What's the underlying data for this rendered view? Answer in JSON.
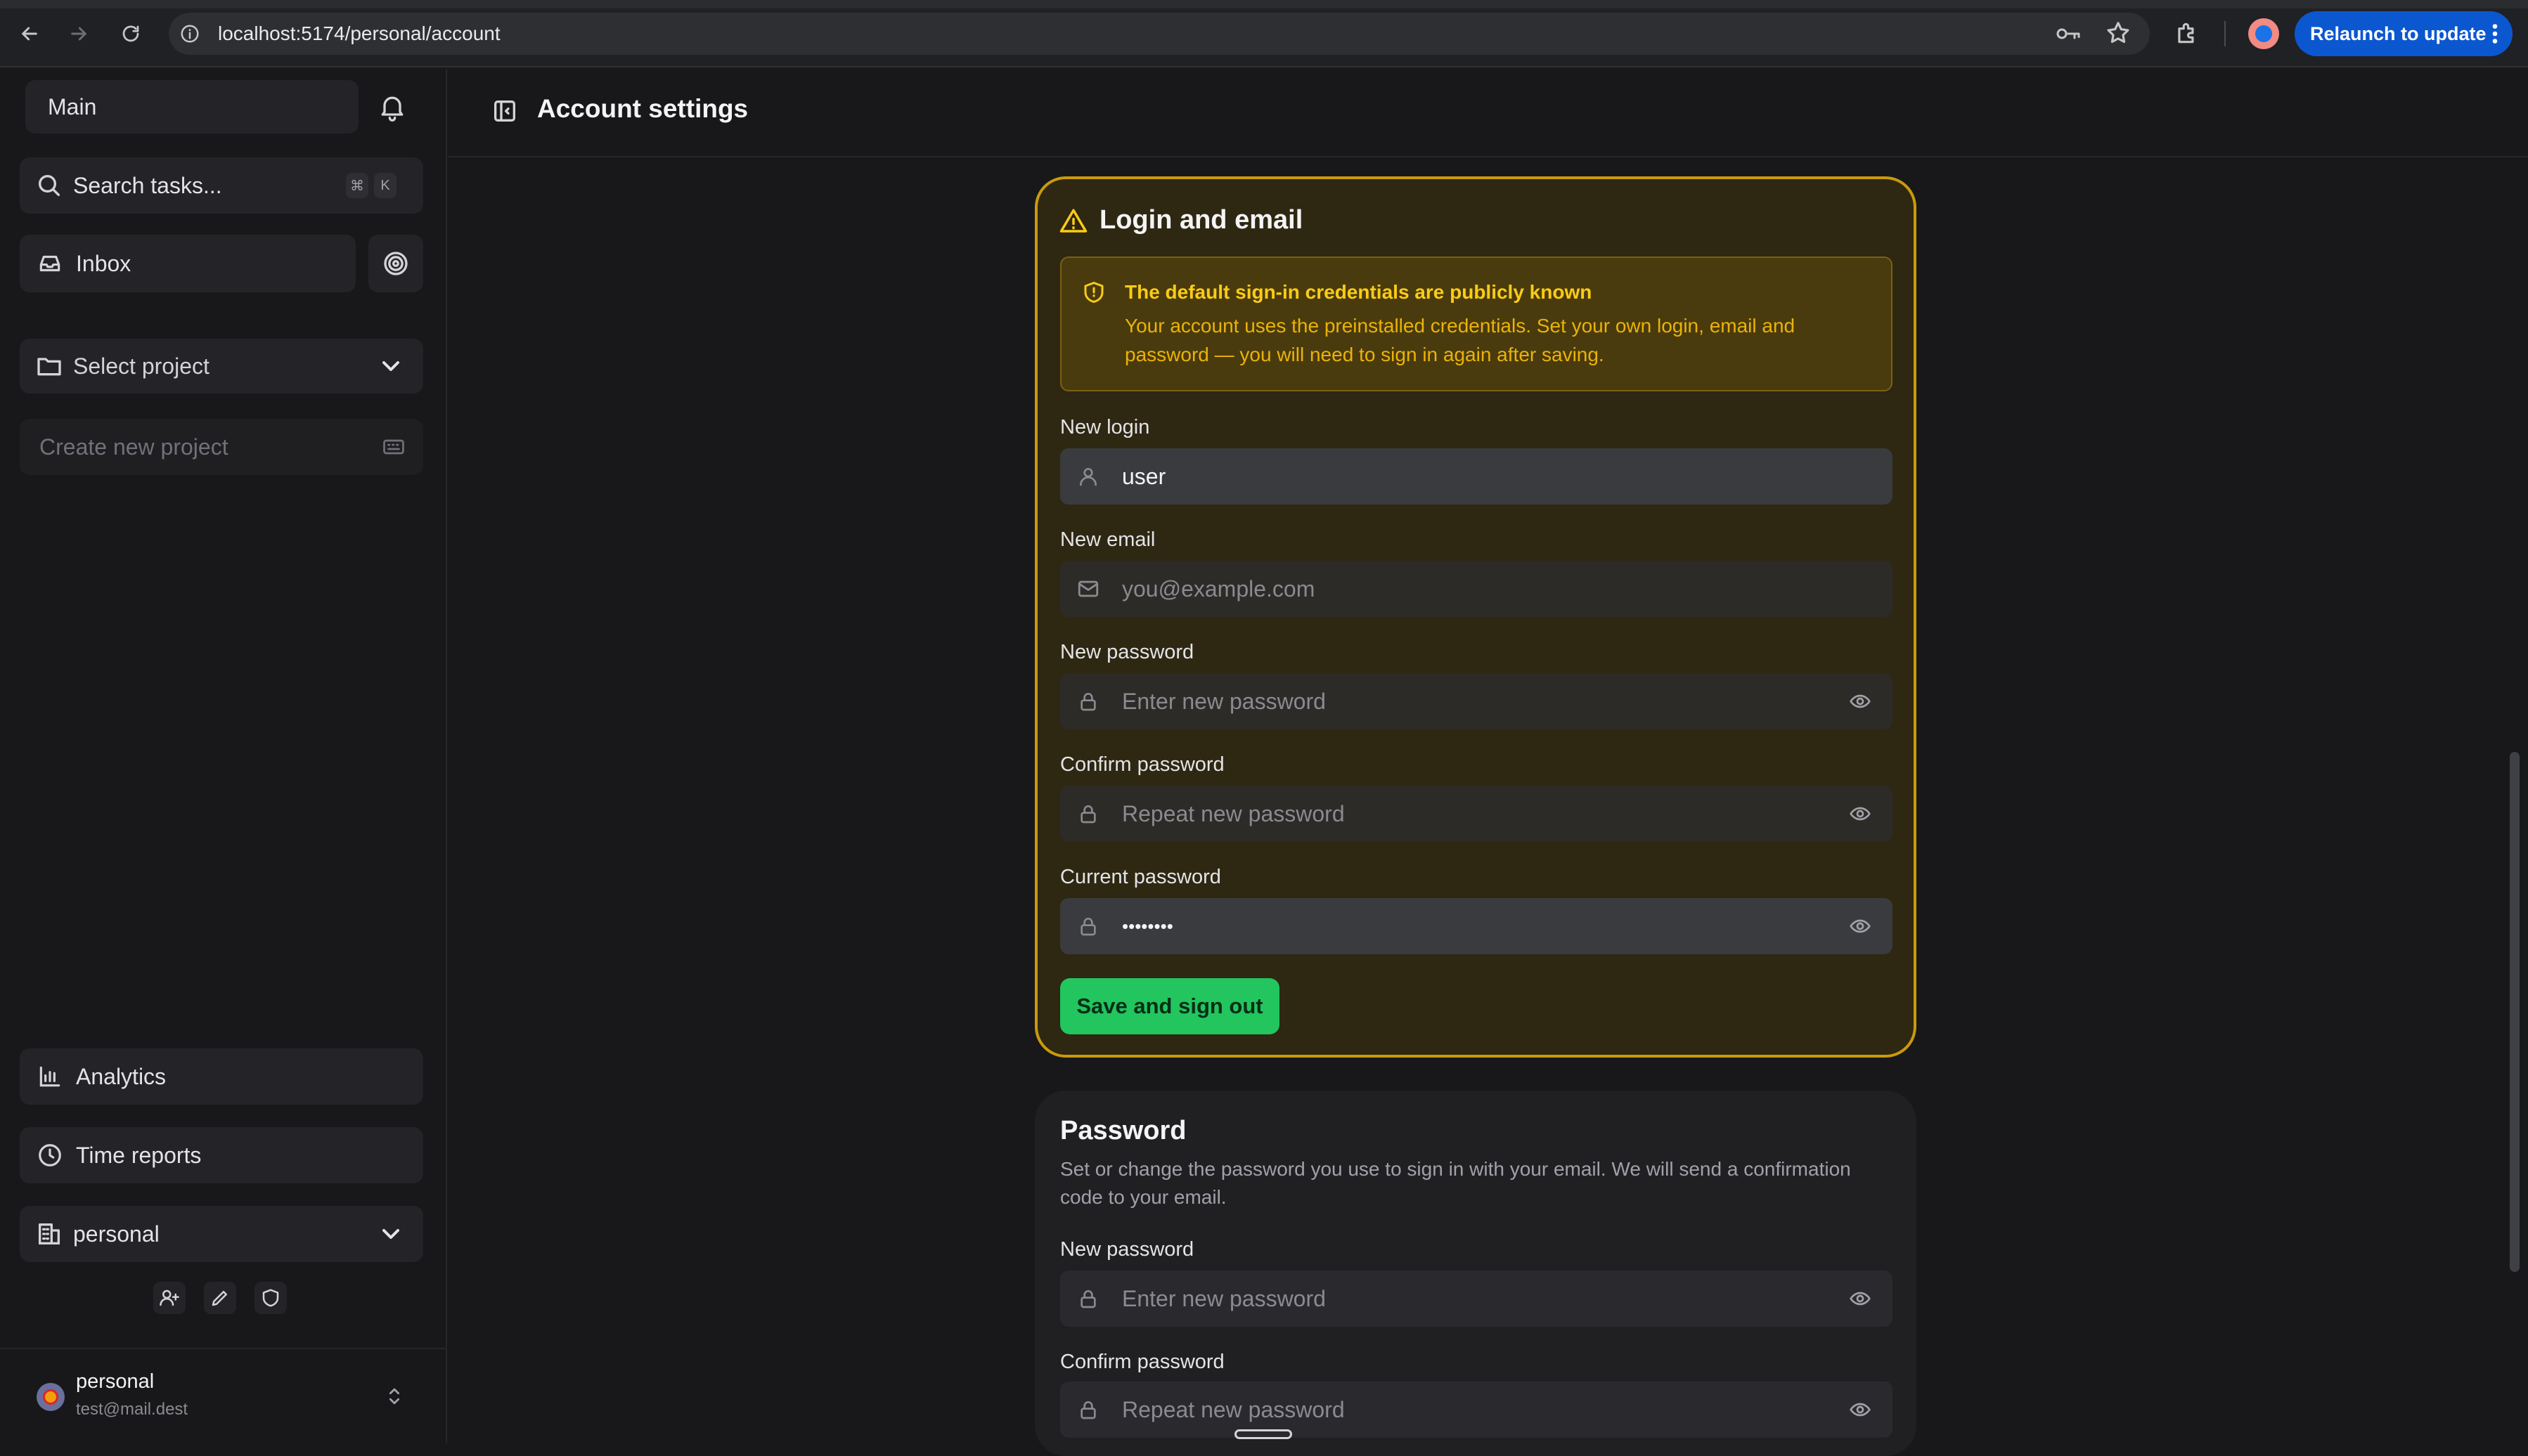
{
  "browser": {
    "url": "localhost:5174/personal/account",
    "relaunch_label": "Relaunch to update"
  },
  "sidebar": {
    "workspace_label": "Main",
    "search_label": "Search tasks...",
    "search_kbd_mod": "⌘",
    "search_kbd_key": "K",
    "inbox_label": "Inbox",
    "project_select_label": "Select project",
    "create_project_placeholder": "Create new project",
    "analytics_label": "Analytics",
    "time_reports_label": "Time reports",
    "organization_label": "personal",
    "user": {
      "name": "personal",
      "email": "test@mail.dest"
    }
  },
  "header": {
    "title": "Account settings"
  },
  "login_card": {
    "title": "Login and email",
    "alert_title": "The default sign-in credentials are publicly known",
    "alert_body": "Your account uses the preinstalled credentials. Set your own login, email and password — you will need to sign in again after saving.",
    "fields": {
      "login": {
        "label": "New login",
        "value": "user"
      },
      "email": {
        "label": "New email",
        "placeholder": "you@example.com"
      },
      "new_password": {
        "label": "New password",
        "placeholder": "Enter new password"
      },
      "confirm_password": {
        "label": "Confirm password",
        "placeholder": "Repeat new password"
      },
      "current_password": {
        "label": "Current password",
        "value": "••••••••"
      }
    },
    "submit_label": "Save and sign out"
  },
  "password_card": {
    "title": "Password",
    "description": "Set or change the password you use to sign in with your email. We will send a confirmation code to your email.",
    "fields": {
      "new_password": {
        "label": "New password",
        "placeholder": "Enter new password"
      },
      "confirm_password": {
        "label": "Confirm password",
        "placeholder": "Repeat new password"
      }
    }
  },
  "colors": {
    "accent_green": "#22c55e",
    "warning_border": "#ca9a0a",
    "warning_text": "#facc15",
    "browser_blue": "#0b57d0"
  }
}
